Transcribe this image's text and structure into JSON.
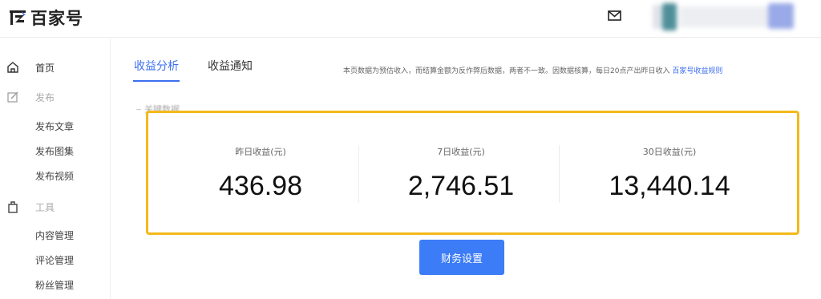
{
  "header": {
    "logo_text": "百家号",
    "mail_icon": "mail-icon",
    "avatar": "blurred-user-avatar"
  },
  "sidebar": {
    "home": {
      "icon": "home-icon",
      "label": "首页"
    },
    "publish": {
      "icon": "edit-icon",
      "label": "发布",
      "items": [
        {
          "label": "发布文章"
        },
        {
          "label": "发布图集"
        },
        {
          "label": "发布视频"
        }
      ]
    },
    "tools": {
      "icon": "bag-icon",
      "label": "工具",
      "items": [
        {
          "label": "内容管理"
        },
        {
          "label": "评论管理"
        },
        {
          "label": "粉丝管理"
        }
      ]
    }
  },
  "tabs": [
    {
      "label": "收益分析",
      "active": true
    },
    {
      "label": "收益通知",
      "active": false
    }
  ],
  "notice": {
    "text": "本页数据为预估收入，而结算金额为反作弊后数据，两者不一致。因数据核算，每日20点产出昨日收入",
    "link": "百家号收益规则"
  },
  "section_label": "关键数据",
  "stats": [
    {
      "label": "昨日收益(元)",
      "value": "436.98"
    },
    {
      "label": "7日收益(元)",
      "value": "2,746.51"
    },
    {
      "label": "30日收益(元)",
      "value": "13,440.14"
    }
  ],
  "finance_button": "财务设置",
  "colors": {
    "accent": "#3c6ef0",
    "button": "#3c7cf6",
    "highlight_border": "#f5b81c"
  }
}
